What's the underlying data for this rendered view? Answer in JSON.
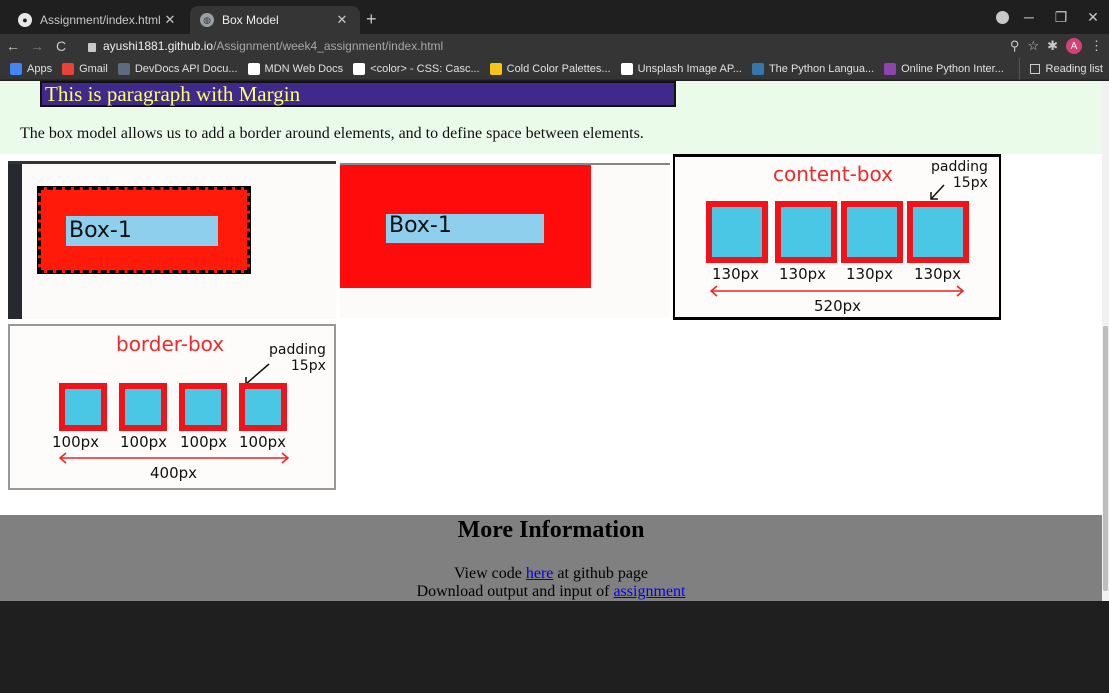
{
  "browser": {
    "tabs": [
      {
        "title": "Assignment/index.html at main ·",
        "active": false,
        "icon": "github-icon"
      },
      {
        "title": "Box Model",
        "active": true,
        "icon": "globe-icon"
      }
    ],
    "new_tab": "+",
    "url_host": "ayushi1881.github.io",
    "url_path": "/Assignment/week4_assignment/index.html",
    "avatar_letter": "A",
    "bookmarks": [
      {
        "label": "Apps",
        "icon": "apps-grid-icon",
        "color": "#4285f4"
      },
      {
        "label": "Gmail",
        "icon": "gmail-icon",
        "color": "#ea4335"
      },
      {
        "label": "DevDocs API Docu...",
        "icon": "devdocs-icon",
        "color": "#5a6c7d"
      },
      {
        "label": "MDN Web Docs",
        "icon": "mdn-icon",
        "color": "#ffffff"
      },
      {
        "label": "<color> - CSS: Casc...",
        "icon": "mdn-icon",
        "color": "#ffffff"
      },
      {
        "label": "Cold Color Palettes...",
        "icon": "palette-icon",
        "color": "#f5c518"
      },
      {
        "label": "Unsplash Image AP...",
        "icon": "unsplash-icon",
        "color": "#ffffff"
      },
      {
        "label": "The Python Langua...",
        "icon": "python-icon",
        "color": "#3776ab"
      },
      {
        "label": "Online Python Inter...",
        "icon": "python-interpreter-icon",
        "color": "#8e44ad"
      }
    ],
    "reading_list": "Reading list"
  },
  "page": {
    "margin_paragraph": "This is paragraph with Margin",
    "box_model_description": "The box model allows us to add a border around elements, and to define space between elements.",
    "image1_label": "Box-1",
    "image2_label": "Box-1",
    "content_box": {
      "title": "content-box",
      "padding_label": "padding",
      "padding_value": "15px",
      "sizes": [
        "130px",
        "130px",
        "130px",
        "130px"
      ],
      "total": "520px"
    },
    "border_box": {
      "title": "border-box",
      "padding_label": "padding",
      "padding_value": "15px",
      "sizes": [
        "100px",
        "100px",
        "100px",
        "100px"
      ],
      "total": "400px"
    },
    "more_info": {
      "heading": "More Information",
      "line1_prefix": "View code ",
      "line1_link": "here",
      "line1_suffix": " at github page",
      "line2_prefix": "Download output and input of ",
      "line2_link": "assignment"
    }
  }
}
